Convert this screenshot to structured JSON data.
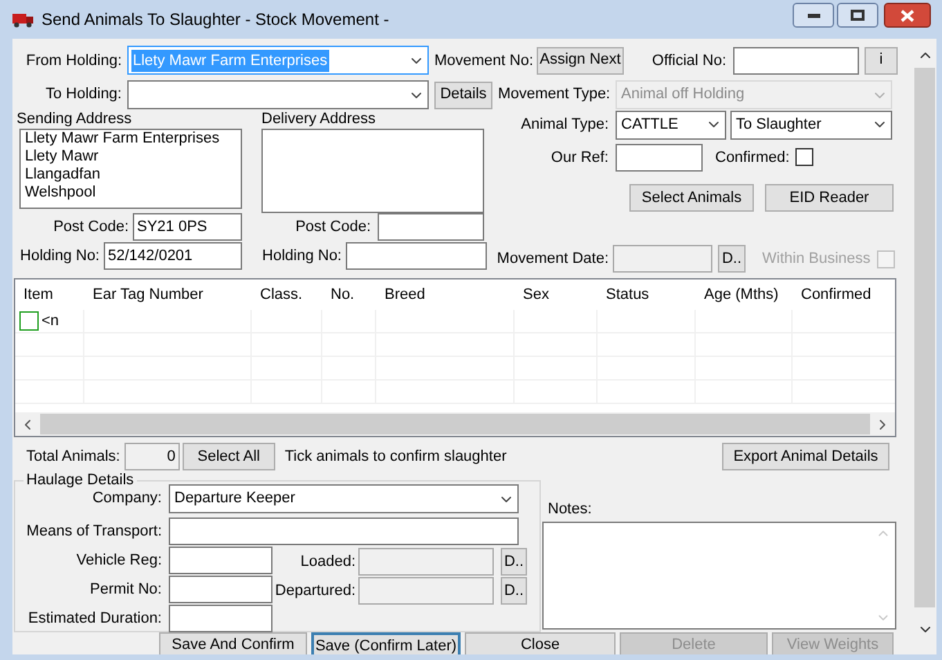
{
  "window": {
    "title": "Send Animals To Slaughter - Stock Movement -"
  },
  "from_holding": {
    "label": "From Holding:",
    "value": "Llety Mawr Farm Enterprises",
    "highlighted": true
  },
  "movement_no": {
    "label": "Movement No:",
    "button": "Assign Next"
  },
  "official_no": {
    "label": "Official No:",
    "button": "i"
  },
  "to_holding": {
    "label": "To Holding:",
    "button": "Details"
  },
  "movement_type": {
    "label": "Movement Type:",
    "value": "Animal off Holding",
    "disabled": true
  },
  "sending_address": {
    "label": "Sending Address",
    "lines": [
      "Llety Mawr Farm Enterprises",
      "Llety Mawr",
      "Llangadfan",
      "Welshpool"
    ],
    "post_code_label": "Post Code:",
    "post_code": "SY21 0PS",
    "holding_no_label": "Holding No:",
    "holding_no": "52/142/0201"
  },
  "delivery_address": {
    "label": "Delivery Address",
    "post_code_label": "Post Code:",
    "holding_no_label": "Holding No:"
  },
  "animal_type": {
    "label": "Animal Type:",
    "value": "CATTLE",
    "purpose": "To Slaughter"
  },
  "our_ref": {
    "label": "Our Ref:"
  },
  "confirmed": {
    "label": "Confirmed:",
    "checked": false
  },
  "actions": [
    "Select Animals",
    "EID Reader"
  ],
  "movement_date": {
    "label": "Movement Date:",
    "button": "D..",
    "disabled": true
  },
  "within_business": {
    "label": "Within Business",
    "checked": false,
    "disabled": true
  },
  "table": {
    "columns": [
      "Item",
      "Ear Tag Number",
      "Class.",
      "No.",
      "Breed",
      "Sex",
      "Status",
      "Age (Mths)",
      "Confirmed"
    ],
    "rows": [
      {
        "checked": false,
        "item": "<n"
      }
    ]
  },
  "totals": {
    "label": "Total Animals:",
    "value": "0",
    "button": "Select All",
    "hint": "Tick animals to confirm slaughter",
    "export_button": "Export Animal Details"
  },
  "haulage": {
    "title": "Haulage Details",
    "company": {
      "label": "Company:",
      "value": "Departure Keeper"
    },
    "means": {
      "label": "Means of Transport:"
    },
    "fields": [
      {
        "label": "Vehicle Reg:"
      },
      {
        "label": "Permit No:"
      },
      {
        "label": "Estimated Duration:"
      }
    ],
    "times": [
      {
        "label": "Loaded:",
        "button": "D..",
        "disabled": true
      },
      {
        "label": "Departured:",
        "button": "D..",
        "disabled": true
      }
    ]
  },
  "notes": {
    "label": "Notes:"
  },
  "buttons": [
    {
      "label": "Save And Confirm",
      "disabled": false,
      "focused": false
    },
    {
      "label": "Save (Confirm Later)",
      "disabled": false,
      "focused": true
    },
    {
      "label": "Close",
      "disabled": false,
      "focused": false
    },
    {
      "label": "Delete",
      "disabled": true,
      "focused": false
    },
    {
      "label": "View Weights",
      "disabled": true,
      "focused": false
    }
  ]
}
